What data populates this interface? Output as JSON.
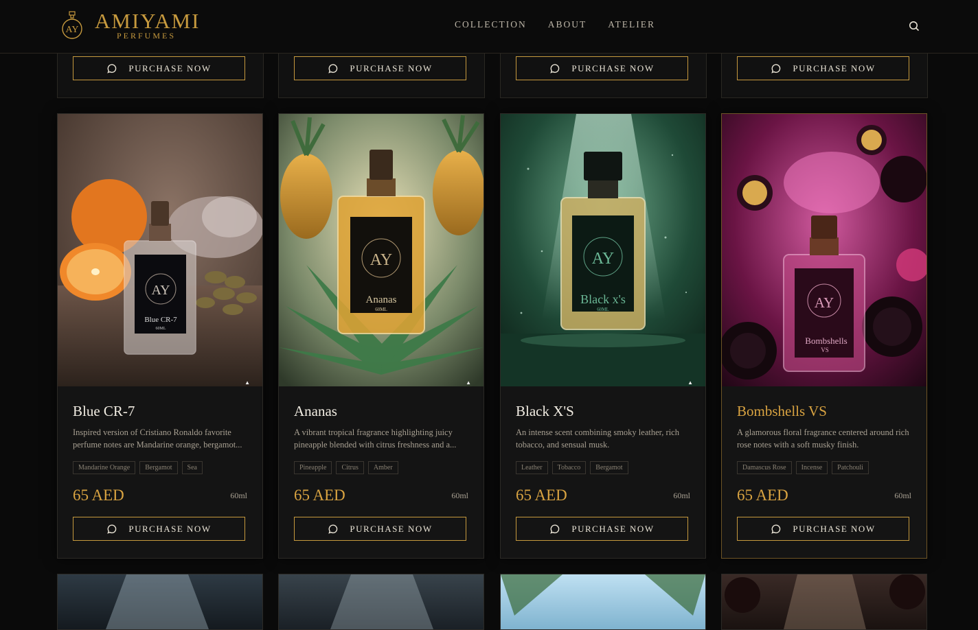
{
  "brand": {
    "name": "AMIYAMI",
    "sub": "PERFUMES"
  },
  "nav": {
    "items": [
      "COLLECTION",
      "ABOUT",
      "ATELIER"
    ]
  },
  "top_row": {
    "button_label": "PURCHASE NOW"
  },
  "products": [
    {
      "name": "Blue CR-7",
      "description": "Inspired version of Cristiano Ronaldo favorite perfume notes are Mandarine orange, bergamot...",
      "tags": [
        "Mandarine Orange",
        "Bergamot",
        "Sea"
      ],
      "price": "65 AED",
      "size": "60ml",
      "button_label": "PURCHASE NOW",
      "label_name": "Blue CR-7",
      "label_size": "60ML"
    },
    {
      "name": "Ananas",
      "description": "A vibrant tropical fragrance highlighting juicy pineapple blended with citrus freshness and a...",
      "tags": [
        "Pineapple",
        "Citrus",
        "Amber"
      ],
      "price": "65 AED",
      "size": "60ml",
      "button_label": "PURCHASE NOW",
      "label_name": "Ananas",
      "label_size": "60ML"
    },
    {
      "name": "Black X'S",
      "description": "An intense scent combining smoky leather, rich tobacco, and sensual musk.",
      "tags": [
        "Leather",
        "Tobacco",
        "Bergamot"
      ],
      "price": "65 AED",
      "size": "60ml",
      "button_label": "PURCHASE NOW",
      "label_name": "Black x's",
      "label_size": "60ML"
    },
    {
      "name": "Bombshells VS",
      "description": "A glamorous floral fragrance centered around rich rose notes with a soft musky finish.",
      "tags": [
        "Damascus Rose",
        "Incense",
        "Patchouli"
      ],
      "price": "65 AED",
      "size": "60ml",
      "button_label": "PURCHASE NOW",
      "label_name": "Bombshells",
      "label_size": "VS"
    }
  ],
  "theme": {
    "gold": "#c79a3e",
    "accent_price": "#d9a341",
    "background": "#0a0a0a"
  }
}
